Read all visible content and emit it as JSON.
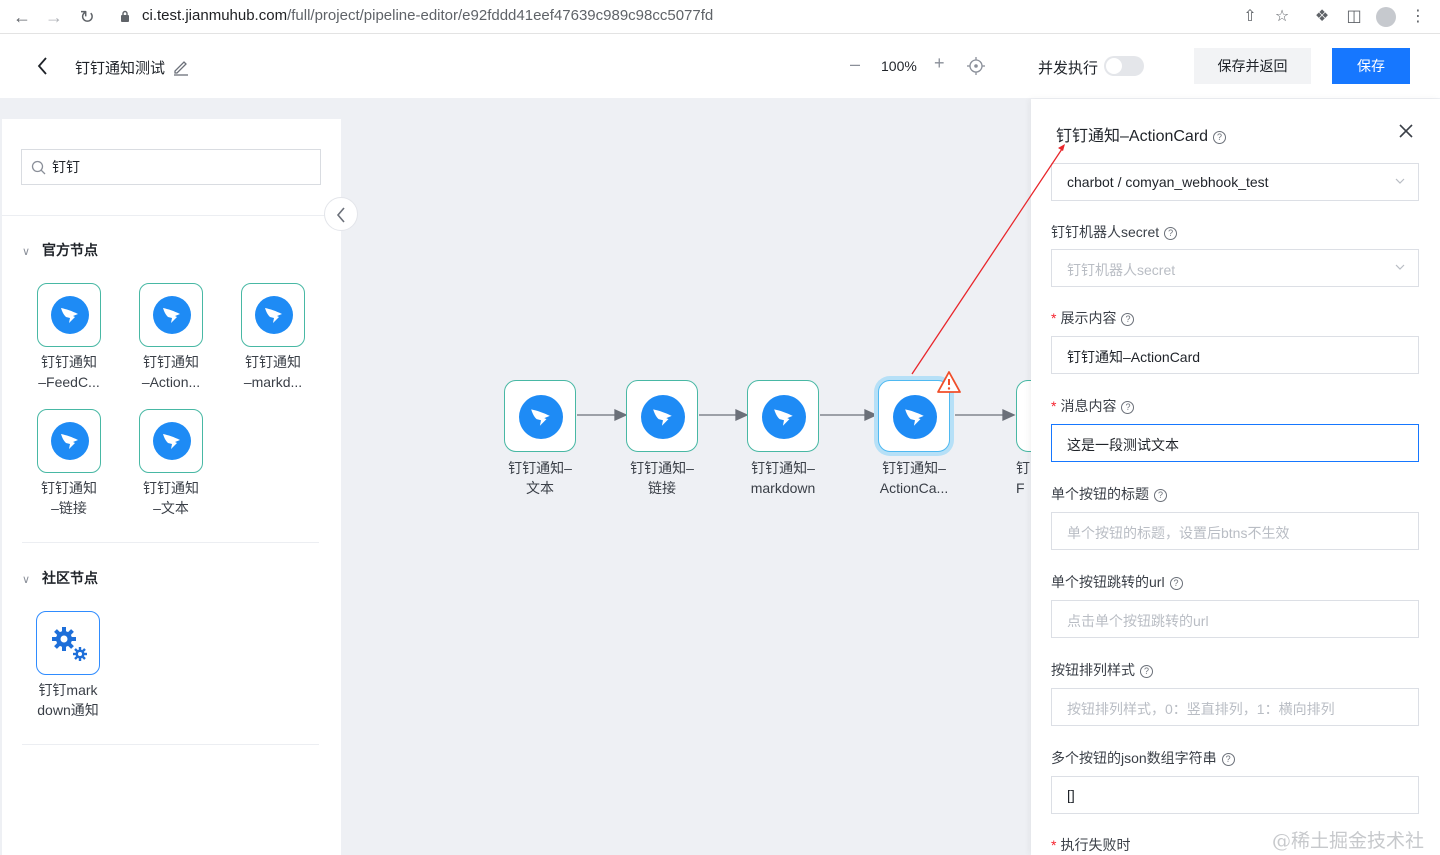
{
  "browser": {
    "url_host": "ci.test.jianmuhub.com",
    "url_path": "/full/project/pipeline-editor/e92fddd41eef47639c989c98cc5077fd"
  },
  "header": {
    "pipeline_title": "钉钉通知测试",
    "zoom_value": "100%",
    "parallel_label": "并发执行",
    "parallel_enabled": false,
    "save_return_label": "保存并返回",
    "save_label": "保存",
    "accent_color": "#1677ff"
  },
  "left_panel": {
    "search_value": "钉钉",
    "official_section": "官方节点",
    "official_nodes": [
      {
        "line1": "钉钉通知",
        "line2": "–FeedC..."
      },
      {
        "line1": "钉钉通知",
        "line2": "–Action..."
      },
      {
        "line1": "钉钉通知",
        "line2": "–markd..."
      },
      {
        "line1": "钉钉通知",
        "line2": "–链接"
      },
      {
        "line1": "钉钉通知",
        "line2": "–文本"
      }
    ],
    "community_section": "社区节点",
    "community_nodes": [
      {
        "line1": "钉钉mark",
        "line2": "down通知"
      }
    ]
  },
  "canvas": {
    "nodes": [
      {
        "line1": "钉钉通知–",
        "line2": "文本"
      },
      {
        "line1": "钉钉通知–",
        "line2": "链接"
      },
      {
        "line1": "钉钉通知–",
        "line2": "markdown"
      },
      {
        "line1": "钉钉通知–",
        "line2": "ActionCa..."
      },
      {
        "line1": "钉",
        "line2": "F"
      }
    ]
  },
  "right_panel": {
    "title": "钉钉通知–ActionCard",
    "webhook_value": "charbot / comyan_webhook_test",
    "secret_label": "钉钉机器人secret",
    "secret_placeholder": "钉钉机器人secret",
    "display_label": "展示内容",
    "display_value": "钉钉通知–ActionCard",
    "message_label": "消息内容",
    "message_value": "这是一段测试文本",
    "btn_title_label": "单个按钮的标题",
    "btn_title_placeholder": "单个按钮的标题，设置后btns不生效",
    "btn_url_label": "单个按钮跳转的url",
    "btn_url_placeholder": "点击单个按钮跳转的url",
    "btn_layout_label": "按钮排列样式",
    "btn_layout_placeholder": "按钮排列样式，0：竖直排列，1：横向排列",
    "btns_json_label": "多个按钮的json数组字符串",
    "btns_json_value": "[]",
    "fail_label": "执行失败时"
  },
  "watermark": "@稀土掘金技术社区"
}
